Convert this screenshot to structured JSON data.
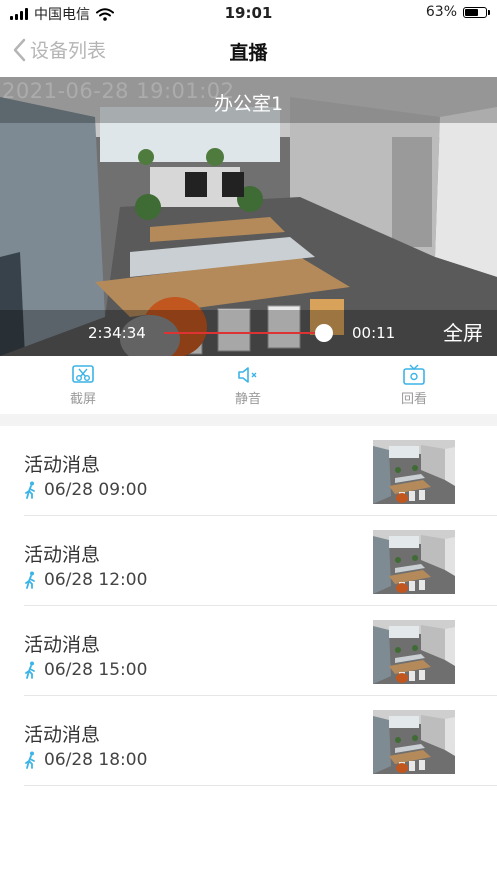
{
  "status_bar": {
    "carrier": "中国电信",
    "time": "19:01",
    "battery_percent": "63%",
    "battery_level": 0.63
  },
  "nav": {
    "back_label": "设备列表",
    "title": "直播"
  },
  "video": {
    "timestamp_overlay": "2021-06-28 19:01:02",
    "camera_name": "办公室1",
    "elapsed": "2:34:34",
    "remaining": "00:11",
    "progress": 0.94,
    "fullscreen_label": "全屏"
  },
  "toolbar": {
    "screenshot_label": "截屏",
    "mute_label": "静音",
    "playback_label": "回看"
  },
  "events": [
    {
      "title": "活动消息",
      "time": "06/28 09:00"
    },
    {
      "title": "活动消息",
      "time": "06/28 12:00"
    },
    {
      "title": "活动消息",
      "time": "06/28 15:00"
    },
    {
      "title": "活动消息",
      "time": "06/28 18:00"
    }
  ],
  "colors": {
    "accent": "#3cb4e6",
    "progress": "#dd3333",
    "muted_text": "#9a9a9a"
  }
}
